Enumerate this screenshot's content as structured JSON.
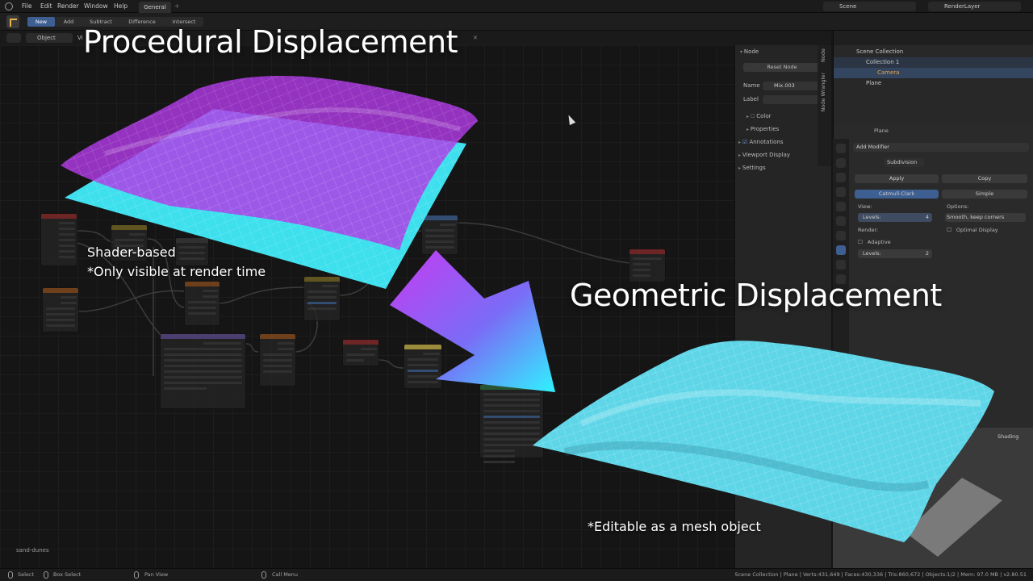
{
  "menu": {
    "items": [
      "File",
      "Edit",
      "Render",
      "Window",
      "Help"
    ],
    "workspace_tab": "General",
    "add_tab": "+",
    "scene_name": "Scene",
    "render_layer": "RenderLayer"
  },
  "tool_header": {
    "modes": [
      "New",
      "Add",
      "Subtract",
      "Difference",
      "Intersect"
    ],
    "active_mode": "New"
  },
  "editor_header": {
    "object_mode": "Object",
    "view_label": "Vi"
  },
  "n_panel": {
    "tabs": [
      "Node",
      "Node Wrangler"
    ],
    "section_node": "Node",
    "reset_button": "Reset Node",
    "name_label": "Name",
    "name_value": "Mix.003",
    "label_label": "Label",
    "color_label": "Color",
    "properties_label": "Properties",
    "annotations_label": "Annotations",
    "viewport_display_label": "Viewport Display",
    "settings_label": "Settings"
  },
  "outliner": {
    "scene_collection": "Scene Collection",
    "collection": "Collection 1",
    "camera": "Camera",
    "plane": "Plane"
  },
  "properties": {
    "object_name": "Plane",
    "add_modifier": "Add Modifier",
    "modifier_name": "Subdivision",
    "apply": "Apply",
    "copy": "Copy",
    "catmull_clark": "Catmull-Clark",
    "simple": "Simple",
    "view_label": "View:",
    "levels_label": "Levels:",
    "levels_viewport": "4",
    "render_label": "Render:",
    "adaptive_label": "Adaptive",
    "levels_render": "2",
    "options_label": "Options:",
    "smooth_option": "Smooth, keep corners",
    "optimal_display": "Optimal Display"
  },
  "viewport": {
    "shading_label": "Shading"
  },
  "status_bar": {
    "select": "Select",
    "box_select": "Box Select",
    "pan_view": "Pan View",
    "call_menu": "Call Menu",
    "stats": "Scene Collection | Plane | Verts:431,649 | Faces:430,336 | Tris:860,672 | Objects:1/2 | Mem: 97.0 MB | v2.80.51"
  },
  "overlay": {
    "title_procedural": "Procedural Displacement",
    "caption_shader": "Shader-based",
    "caption_render": "*Only visible at render time",
    "title_geometric": "Geometric Displacement",
    "caption_editable": "*Editable as a mesh object",
    "file_label": "sand-dunes"
  },
  "colors": {
    "procedural_plane": "#b040e0",
    "base_plane": "#3ee0ee",
    "arrow_start": "#c03cf0",
    "arrow_end": "#2ff0ff",
    "mesh": "#5fd6e8",
    "active_blue": "#3e5f92"
  }
}
